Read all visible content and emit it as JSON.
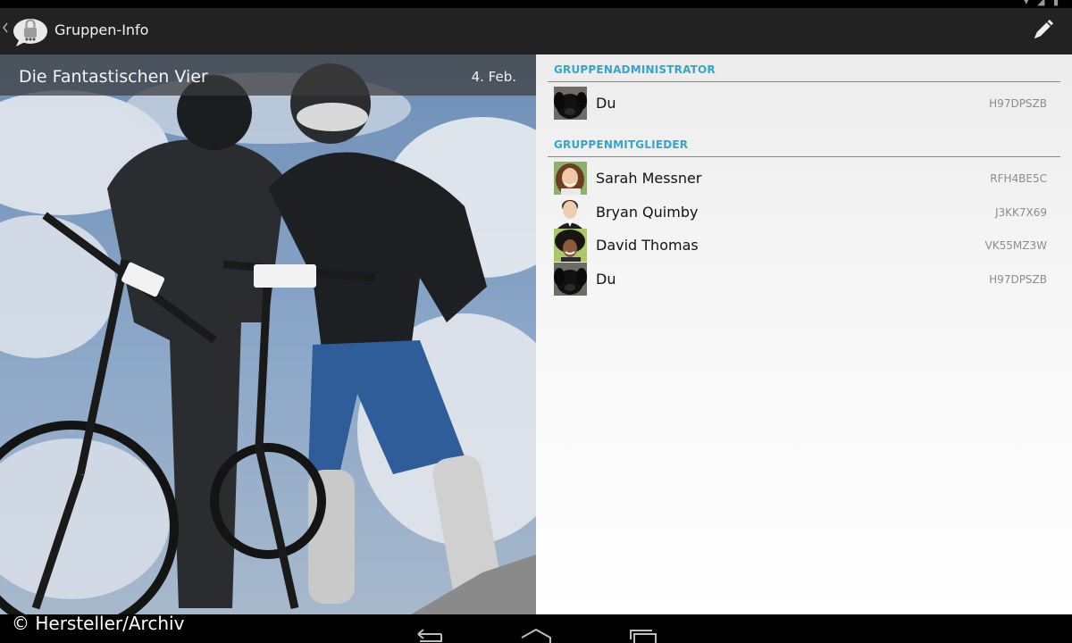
{
  "action_bar": {
    "title": "Gruppen-Info",
    "up_icon": "chevron-left-icon",
    "app_icon": "lock-chat-icon",
    "edit_icon": "pencil-icon"
  },
  "group": {
    "name": "Die Fantastischen Vier",
    "date": "4. Feb."
  },
  "sections": {
    "admin_header": "GRUPPENADMINISTRATOR",
    "members_header": "GRUPPENMITGLIEDER"
  },
  "admins": [
    {
      "name": "Du",
      "id": "H97DPSZB",
      "avatar": "dog-avatar"
    }
  ],
  "members": [
    {
      "name": "Sarah Messner",
      "id": "RFH4BE5C",
      "avatar": "woman-avatar"
    },
    {
      "name": "Bryan Quimby",
      "id": "J3KK7X69",
      "avatar": "man-avatar"
    },
    {
      "name": "David Thomas",
      "id": "VK55MZ3W",
      "avatar": "curly-hair-avatar"
    },
    {
      "name": "Du",
      "id": "H97DPSZB",
      "avatar": "dog-avatar"
    }
  ],
  "watermark": "© Hersteller/Archiv",
  "colors": {
    "accent": "#33a6cc",
    "action_bar": "#222222"
  }
}
